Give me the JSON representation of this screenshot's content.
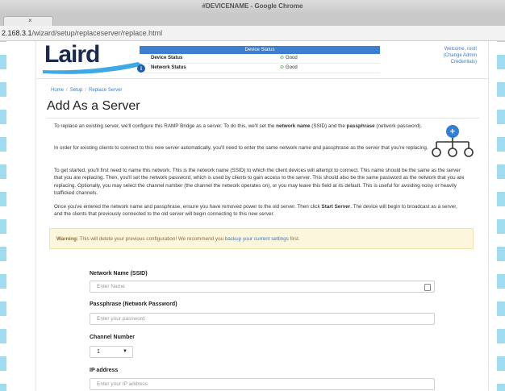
{
  "window": {
    "title": "#DEVICENAME - Google Chrome"
  },
  "tab": {
    "close_glyph": "×"
  },
  "address": {
    "host": "2.168.3.1",
    "path": "/wizard/setup/replaceserver/replace.html"
  },
  "header": {
    "logo_text": "Laird",
    "status": {
      "heading": "Device Status",
      "rows": [
        {
          "label": "Device Status",
          "value": "Good"
        },
        {
          "label": "Network Status",
          "value": "Good"
        }
      ]
    },
    "welcome_text": "Welcome, root!",
    "change_link_line1": "(Change Admin",
    "change_link_line2": "Credentials)"
  },
  "breadcrumb": [
    "Home",
    "Setup",
    "Replace Server"
  ],
  "page_title": "Add As a Server",
  "paragraphs": {
    "p1_a": "To replace an existing server, we'll configure this RAMP Bridge as a server. To do this, we'll set the ",
    "p1_b": "network name",
    "p1_c": " (SSID) and the ",
    "p1_d": "passphrase",
    "p1_e": " (network password).",
    "p2": "In order for existing clients to connect to this new server automatically, you'll need to enter the same network name and passphrase as the server that you're replacing.",
    "p3": "To get started, you'll first need to name this network. This is the network name (SSID) to which the client devices will attempt to connect. This name should be the same as the server that you are replacing. Then, you'll set the network password, which is used by clients to gain access to the server. This should also be the same password as the network that you are replacing. Optionally, you may select the channel number (the channel the network operates on), or you may leave this field at its default. This is useful for avoiding noisy or heavily trafficked channels.",
    "p4_a": "Once you've entered the network name and passphrase, ensure you have removed power to the old server. Then click ",
    "p4_b": "Start Server",
    "p4_c": ". The device will begin to broadcast as a server, and the clients that previously connected to the old server will begin connecting to this new server."
  },
  "warning": {
    "label": "Warning:",
    "text_a": " This will delete your previous configuration! We recommend you ",
    "link": "backup your current settings",
    "text_b": " first."
  },
  "form": {
    "ssid_label": "Network Name (SSID)",
    "ssid_placeholder": "Enter Name",
    "pass_label": "Passphrase (Network Password)",
    "pass_placeholder": "Enter your password",
    "channel_label": "Channel Number",
    "channel_value": "1",
    "ip_label": "IP address",
    "ip_placeholder": "Enter your IP address"
  },
  "colors": {
    "accent": "#3c7ed0",
    "good": "#2e9e3e",
    "warning_bg": "#fcf6dc"
  }
}
